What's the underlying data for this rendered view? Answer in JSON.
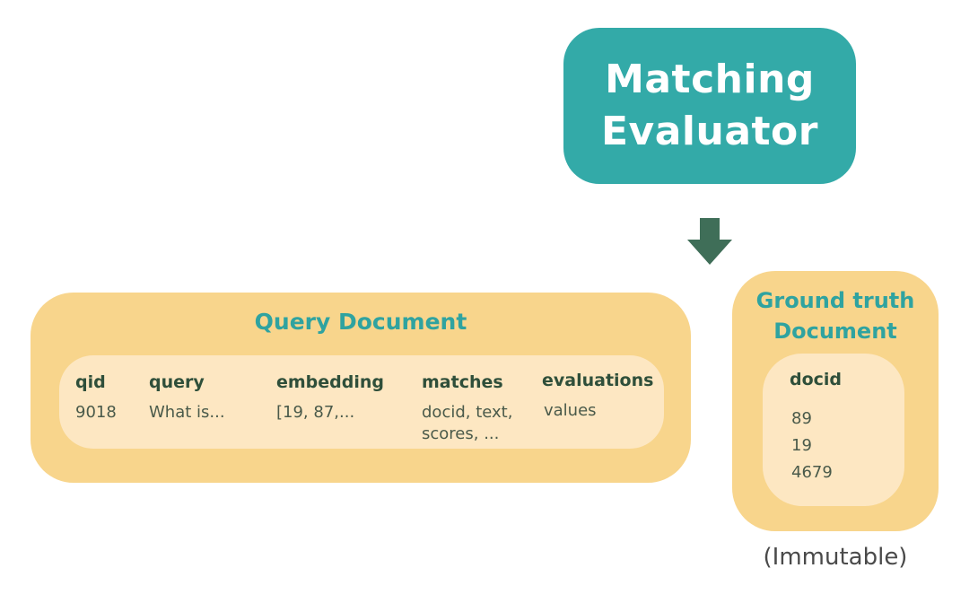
{
  "evaluator": {
    "line1": "Matching",
    "line2": "Evaluator",
    "color": "#33aaa8"
  },
  "query_document": {
    "title": "Query Document",
    "columns": [
      {
        "header": "qid",
        "value": "9018"
      },
      {
        "header": "query",
        "value": "What is..."
      },
      {
        "header": "embedding",
        "value": "[19, 87,..."
      },
      {
        "header": "matches",
        "value": "docid, text, scores, ..."
      },
      {
        "header": "evaluations",
        "value": "values"
      }
    ]
  },
  "ground_truth_document": {
    "title_line1": "Ground truth",
    "title_line2": "Document",
    "header": "docid",
    "values": [
      "89",
      "19",
      "4679"
    ],
    "note": "(Immutable)"
  },
  "colors": {
    "panel_outer": "#f8d58c",
    "panel_inner": "#fde7c2",
    "title_teal": "#2fa3a0",
    "arrow_green": "#3f6e58"
  }
}
